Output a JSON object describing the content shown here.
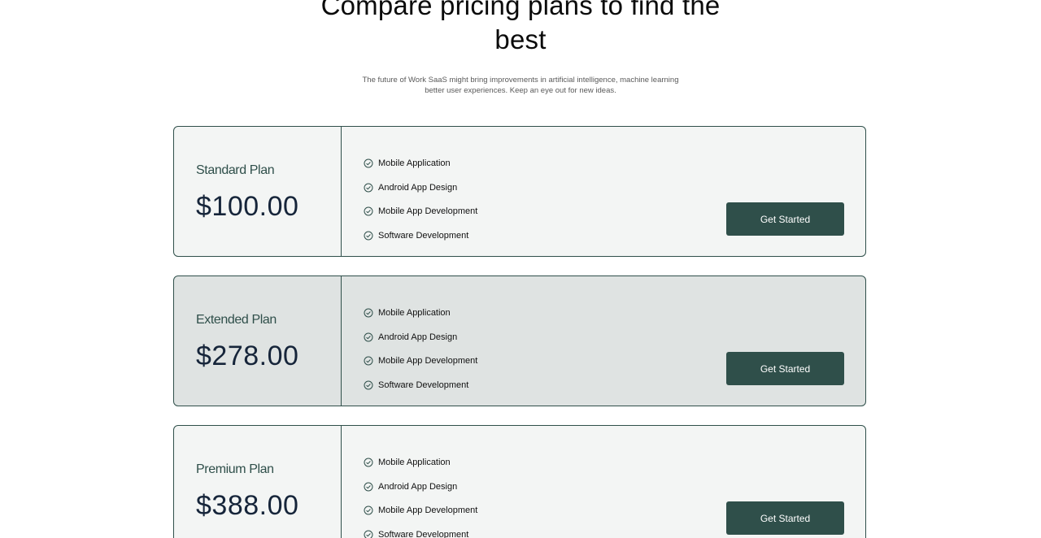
{
  "section": {
    "heading_line1": "Compare pricing plans to find the",
    "heading_line2": "best",
    "subtitle_line1": "The future of Work SaaS might bring improvements in artificial intelligence, machine learning",
    "subtitle_line2": "better user experiences. Keep an eye out for new ideas."
  },
  "plans": [
    {
      "name": "Standard Plan",
      "price": "$100.00",
      "features": [
        "Mobile Application",
        "Android App Design",
        "Mobile App Development",
        "Software Development"
      ],
      "cta": "Get Started",
      "theme": "light"
    },
    {
      "name": "Extended Plan",
      "price": "$278.00",
      "features": [
        "Mobile Application",
        "Android App Design",
        "Mobile App Development",
        "Software Development"
      ],
      "cta": "Get Started",
      "theme": "dark"
    },
    {
      "name": "Premium Plan",
      "price": "$388.00",
      "features": [
        "Mobile Application",
        "Android App Design",
        "Mobile App Development",
        "Software Development"
      ],
      "cta": "Get Started",
      "theme": "light"
    }
  ],
  "icons": {
    "feature": "check-circle-icon"
  },
  "colors": {
    "accent": "#2f4f4a",
    "card_light": "#f3f5f4",
    "card_dark": "#dfe3e2",
    "price": "#16253a"
  }
}
